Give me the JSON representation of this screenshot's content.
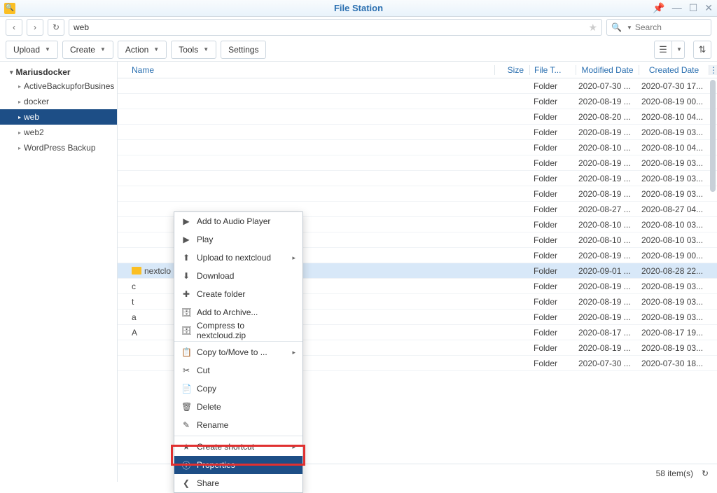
{
  "window": {
    "title": "File Station"
  },
  "nav": {
    "path": "web",
    "search_placeholder": "Search"
  },
  "actions": {
    "upload": "Upload",
    "create": "Create",
    "action": "Action",
    "tools": "Tools",
    "settings": "Settings"
  },
  "sidebar": {
    "root": "Mariusdocker",
    "items": [
      {
        "label": "ActiveBackupforBusines",
        "selected": false
      },
      {
        "label": "docker",
        "selected": false
      },
      {
        "label": "web",
        "selected": true
      },
      {
        "label": "web2",
        "selected": false
      },
      {
        "label": "WordPress Backup",
        "selected": false
      }
    ]
  },
  "columns": {
    "name": "Name",
    "size": "Size",
    "type": "File T...",
    "modified": "Modified Date",
    "created": "Created Date"
  },
  "rows": [
    {
      "name": "",
      "type": "Folder",
      "modified": "2020-07-30 ...",
      "created": "2020-07-30 17..."
    },
    {
      "name": "",
      "type": "Folder",
      "modified": "2020-08-19 ...",
      "created": "2020-08-19 00..."
    },
    {
      "name": "",
      "type": "Folder",
      "modified": "2020-08-20 ...",
      "created": "2020-08-10 04..."
    },
    {
      "name": "",
      "type": "Folder",
      "modified": "2020-08-19 ...",
      "created": "2020-08-19 03..."
    },
    {
      "name": "",
      "type": "Folder",
      "modified": "2020-08-10 ...",
      "created": "2020-08-10 04..."
    },
    {
      "name": "",
      "type": "Folder",
      "modified": "2020-08-19 ...",
      "created": "2020-08-19 03..."
    },
    {
      "name": "",
      "type": "Folder",
      "modified": "2020-08-19 ...",
      "created": "2020-08-19 03..."
    },
    {
      "name": "",
      "type": "Folder",
      "modified": "2020-08-19 ...",
      "created": "2020-08-19 03..."
    },
    {
      "name": "",
      "type": "Folder",
      "modified": "2020-08-27 ...",
      "created": "2020-08-27 04..."
    },
    {
      "name": "",
      "type": "Folder",
      "modified": "2020-08-10 ...",
      "created": "2020-08-10 03..."
    },
    {
      "name": "",
      "type": "Folder",
      "modified": "2020-08-10 ...",
      "created": "2020-08-10 03..."
    },
    {
      "name": "",
      "type": "Folder",
      "modified": "2020-08-19 ...",
      "created": "2020-08-19 00..."
    },
    {
      "name": "nextclo",
      "type": "Folder",
      "modified": "2020-09-01 ...",
      "created": "2020-08-28 22...",
      "selected": true,
      "show_icon": true
    },
    {
      "name": "c",
      "type": "Folder",
      "modified": "2020-08-19 ...",
      "created": "2020-08-19 03..."
    },
    {
      "name": "t",
      "type": "Folder",
      "modified": "2020-08-19 ...",
      "created": "2020-08-19 03..."
    },
    {
      "name": "a",
      "type": "Folder",
      "modified": "2020-08-19 ...",
      "created": "2020-08-19 03..."
    },
    {
      "name": "A",
      "type": "Folder",
      "modified": "2020-08-17 ...",
      "created": "2020-08-17 19..."
    },
    {
      "name": "",
      "type": "Folder",
      "modified": "2020-08-19 ...",
      "created": "2020-08-19 03..."
    },
    {
      "name": "",
      "type": "Folder",
      "modified": "2020-07-30 ...",
      "created": "2020-07-30 18..."
    }
  ],
  "status": {
    "count": "58 item(s)"
  },
  "context_menu": [
    {
      "icon": "▶",
      "label": "Add to Audio Player"
    },
    {
      "icon": "▶",
      "label": "Play"
    },
    {
      "icon": "⬆",
      "label": "Upload to nextcloud",
      "submenu": true
    },
    {
      "icon": "⬇",
      "label": "Download"
    },
    {
      "icon": "✚",
      "label": "Create folder"
    },
    {
      "icon": "🗄",
      "label": "Add to Archive..."
    },
    {
      "icon": "🗄",
      "label": "Compress to nextcloud.zip"
    },
    {
      "sep": true
    },
    {
      "icon": "📋",
      "label": "Copy to/Move to ...",
      "submenu": true
    },
    {
      "icon": "✂",
      "label": "Cut"
    },
    {
      "icon": "📄",
      "label": "Copy"
    },
    {
      "icon": "🗑",
      "label": "Delete"
    },
    {
      "icon": "✎",
      "label": "Rename"
    },
    {
      "sep": true
    },
    {
      "icon": "★",
      "label": "Create shortcut",
      "submenu": true
    },
    {
      "icon": "ⓘ",
      "label": "Properties",
      "highlighted": true
    },
    {
      "icon": "❮",
      "label": "Share"
    }
  ]
}
